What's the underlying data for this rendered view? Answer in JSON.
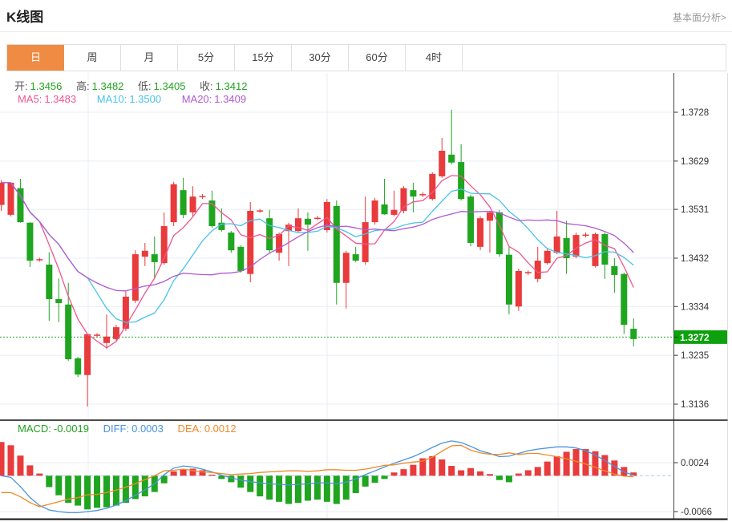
{
  "header": {
    "title": "K线图",
    "link": "基本面分析>"
  },
  "tabs": {
    "items": [
      "日",
      "周",
      "月",
      "5分",
      "15分",
      "30分",
      "60分",
      "4时"
    ],
    "active": "日"
  },
  "readout": {
    "open_label": "开:",
    "open": "1.3456",
    "high_label": "高:",
    "high": "1.3482",
    "low_label": "低:",
    "low": "1.3405",
    "close_label": "收:",
    "close": "1.3412",
    "ma5_label": "MA5:",
    "ma5": "1.3483",
    "ma10_label": "MA10:",
    "ma10": "1.3500",
    "ma20_label": "MA20:",
    "ma20": "1.3409",
    "macd_label": "MACD:",
    "macd": "-0.0019",
    "diff_label": "DIFF:",
    "diff": "0.0003",
    "dea_label": "DEA:",
    "dea": "0.0012"
  },
  "colors": {
    "accent_orange": "#ef8b43",
    "up_red": "#e93a3c",
    "down_green": "#1fa51f",
    "value_green": "#21a21f",
    "label_gray": "#555555",
    "link_gray": "#999999",
    "ma5_pink": "#f0558f",
    "ma10_cyan": "#48c2e9",
    "ma20_purple": "#b159d2",
    "diff_blue": "#4a94dc",
    "dea_orange": "#f08a28",
    "badge_green": "#0da10d",
    "price_line_green": "#2aa82a",
    "grid": "#e8eef4",
    "axis_dark": "#444444",
    "separator": "#111111",
    "zero_dashed_blue": "#a6cdf0",
    "tick_text": "#333333",
    "tab_border": "#dfdfdf",
    "tab_text": "#444444",
    "title_text": "#222222"
  },
  "chart_data": [
    {
      "type": "candlestick",
      "title": "K线图 日K",
      "up_means": "red = close >= open, green = close < open",
      "ohlc": [
        [
          1.354,
          1.359,
          1.3528,
          1.3585
        ],
        [
          1.352,
          1.3586,
          1.3517,
          1.3585
        ],
        [
          1.3574,
          1.3593,
          1.3504,
          1.3505
        ],
        [
          1.3504,
          1.3505,
          1.3414,
          1.3427
        ],
        [
          1.3428,
          1.3433,
          1.3425,
          1.343
        ],
        [
          1.3419,
          1.3444,
          1.3305,
          1.3349
        ],
        [
          1.3349,
          1.3391,
          1.3302,
          1.3341
        ],
        [
          1.3338,
          1.3382,
          1.3224,
          1.3227
        ],
        [
          1.3229,
          1.3232,
          1.3191,
          1.3196
        ],
        [
          1.3195,
          1.3278,
          1.3131,
          1.3278
        ],
        [
          1.3275,
          1.328,
          1.3272,
          1.3277
        ],
        [
          1.326,
          1.3318,
          1.3248,
          1.3273
        ],
        [
          1.3268,
          1.3297,
          1.3263,
          1.3292
        ],
        [
          1.3289,
          1.3365,
          1.3284,
          1.3354
        ],
        [
          1.3346,
          1.3448,
          1.3341,
          1.344
        ],
        [
          1.3435,
          1.3463,
          1.3416,
          1.3447
        ],
        [
          1.344,
          1.3476,
          1.339,
          1.3424
        ],
        [
          1.3422,
          1.3525,
          1.3419,
          1.3497
        ],
        [
          1.3505,
          1.3587,
          1.3497,
          1.3582
        ],
        [
          1.357,
          1.3595,
          1.3513,
          1.352
        ],
        [
          1.3525,
          1.3578,
          1.3517,
          1.3557
        ],
        [
          1.3556,
          1.3562,
          1.3552,
          1.3558
        ],
        [
          1.3549,
          1.3569,
          1.3494,
          1.3497
        ],
        [
          1.3504,
          1.3533,
          1.3486,
          1.3489
        ],
        [
          1.3484,
          1.3487,
          1.3443,
          1.3448
        ],
        [
          1.3455,
          1.3458,
          1.3403,
          1.3406
        ],
        [
          1.34,
          1.3546,
          1.3383,
          1.3528
        ],
        [
          1.3527,
          1.3532,
          1.3524,
          1.3529
        ],
        [
          1.3513,
          1.353,
          1.3443,
          1.3448
        ],
        [
          1.3443,
          1.3484,
          1.3427,
          1.3481
        ],
        [
          1.3487,
          1.3504,
          1.3416,
          1.35
        ],
        [
          1.3487,
          1.3533,
          1.3484,
          1.3513
        ],
        [
          1.3512,
          1.3525,
          1.3447,
          1.35
        ],
        [
          1.3512,
          1.3518,
          1.3509,
          1.3514
        ],
        [
          1.3489,
          1.3552,
          1.3484,
          1.3546
        ],
        [
          1.3538,
          1.3549,
          1.3338,
          1.3382
        ],
        [
          1.3382,
          1.3447,
          1.333,
          1.3443
        ],
        [
          1.344,
          1.3455,
          1.3424,
          1.3427
        ],
        [
          1.3424,
          1.3557,
          1.3419,
          1.3505
        ],
        [
          1.3505,
          1.3554,
          1.35,
          1.3549
        ],
        [
          1.3541,
          1.3593,
          1.352,
          1.3521
        ],
        [
          1.352,
          1.3569,
          1.3517,
          1.353
        ],
        [
          1.3528,
          1.3578,
          1.3523,
          1.3574
        ],
        [
          1.357,
          1.3585,
          1.3525,
          1.3557
        ],
        [
          1.356,
          1.3566,
          1.3556,
          1.3562
        ],
        [
          1.3552,
          1.3606,
          1.3549,
          1.3603
        ],
        [
          1.3598,
          1.3676,
          1.3595,
          1.365
        ],
        [
          1.3642,
          1.3733,
          1.3622,
          1.3626
        ],
        [
          1.3627,
          1.3663,
          1.3549,
          1.3552
        ],
        [
          1.3557,
          1.3561,
          1.3456,
          1.3463
        ],
        [
          1.3455,
          1.3517,
          1.3448,
          1.3513
        ],
        [
          1.3508,
          1.3528,
          1.3443,
          1.3525
        ],
        [
          1.3525,
          1.353,
          1.3435,
          1.344
        ],
        [
          1.3439,
          1.3455,
          1.3318,
          1.3338
        ],
        [
          1.3334,
          1.3411,
          1.3325,
          1.3406
        ],
        [
          1.3402,
          1.3407,
          1.3398,
          1.3404
        ],
        [
          1.339,
          1.3455,
          1.3383,
          1.3427
        ],
        [
          1.3422,
          1.3452,
          1.3419,
          1.3447
        ],
        [
          1.3443,
          1.3528,
          1.344,
          1.3476
        ],
        [
          1.3473,
          1.3508,
          1.34,
          1.3432
        ],
        [
          1.3435,
          1.3484,
          1.3432,
          1.3479
        ],
        [
          1.3478,
          1.3484,
          1.3474,
          1.348
        ],
        [
          1.3416,
          1.3484,
          1.3413,
          1.3481
        ],
        [
          1.3481,
          1.3484,
          1.339,
          1.3419
        ],
        [
          1.3416,
          1.3432,
          1.3362,
          1.3398
        ],
        [
          1.34,
          1.3403,
          1.3278,
          1.3297
        ],
        [
          1.3289,
          1.331,
          1.3253,
          1.3268
        ]
      ],
      "ma_periods": [
        5,
        10,
        20
      ],
      "y_ticks": [
        1.3728,
        1.3629,
        1.3531,
        1.3432,
        1.3334,
        1.3235,
        1.3136
      ],
      "ylim": [
        1.3136,
        1.3728
      ],
      "current_price": 1.3272,
      "current_price_label": "1.3272",
      "grid": true,
      "legend_position": "none"
    },
    {
      "type": "bar",
      "title": "MACD",
      "histogram": [
        0.0062,
        0.0056,
        0.0037,
        0.0019,
        0.0004,
        -0.0021,
        -0.0036,
        -0.005,
        -0.0055,
        -0.0062,
        -0.0059,
        -0.0058,
        -0.0055,
        -0.005,
        -0.0043,
        -0.0038,
        -0.003,
        -0.0014,
        0.0008,
        0.0012,
        0.0013,
        0.001,
        0.0002,
        -0.0006,
        -0.0012,
        -0.0022,
        -0.003,
        -0.0038,
        -0.0044,
        -0.0048,
        -0.0052,
        -0.005,
        -0.0046,
        -0.0044,
        -0.0048,
        -0.0052,
        -0.0044,
        -0.0032,
        -0.002,
        -0.0013,
        -0.0006,
        0.0006,
        0.0012,
        0.002,
        0.0032,
        0.0036,
        0.003,
        0.0018,
        0.001,
        0.0014,
        0.0008,
        0.0003,
        -0.0008,
        -0.0012,
        0.0004,
        0.001,
        0.0016,
        0.0026,
        0.0036,
        0.0044,
        0.0049,
        0.0049,
        0.0045,
        0.0038,
        0.0028,
        0.0016,
        0.0006
      ],
      "diff_line": [
        0.0,
        -0.0003,
        -0.002,
        -0.004,
        -0.0055,
        -0.0063,
        -0.0066,
        -0.0068,
        -0.0068,
        -0.0066,
        -0.0064,
        -0.006,
        -0.0054,
        -0.0046,
        -0.0036,
        -0.0026,
        -0.0015,
        0.0002,
        0.0014,
        0.0018,
        0.0016,
        0.0012,
        0.0007,
        0.0001,
        -0.0004,
        -0.0008,
        -0.0011,
        -0.0013,
        -0.0015,
        -0.0016,
        -0.0017,
        -0.0016,
        -0.0015,
        -0.0013,
        -0.0013,
        -0.0015,
        -0.0012,
        -0.0006,
        0.0002,
        0.0009,
        0.0016,
        0.0023,
        0.0029,
        0.0035,
        0.0043,
        0.0052,
        0.006,
        0.0064,
        0.0061,
        0.0054,
        0.0046,
        0.0041,
        0.0035,
        0.0036,
        0.0041,
        0.0046,
        0.0049,
        0.0051,
        0.0053,
        0.0053,
        0.0051,
        0.0046,
        0.0038,
        0.0028,
        0.0017,
        0.0007,
        0.0001
      ],
      "y_ticks": [
        0.0024,
        -0.0066
      ],
      "zero_line_dashed": true,
      "readout": {
        "macd": -0.0019,
        "diff": 0.0003,
        "dea": 0.0012
      }
    }
  ]
}
